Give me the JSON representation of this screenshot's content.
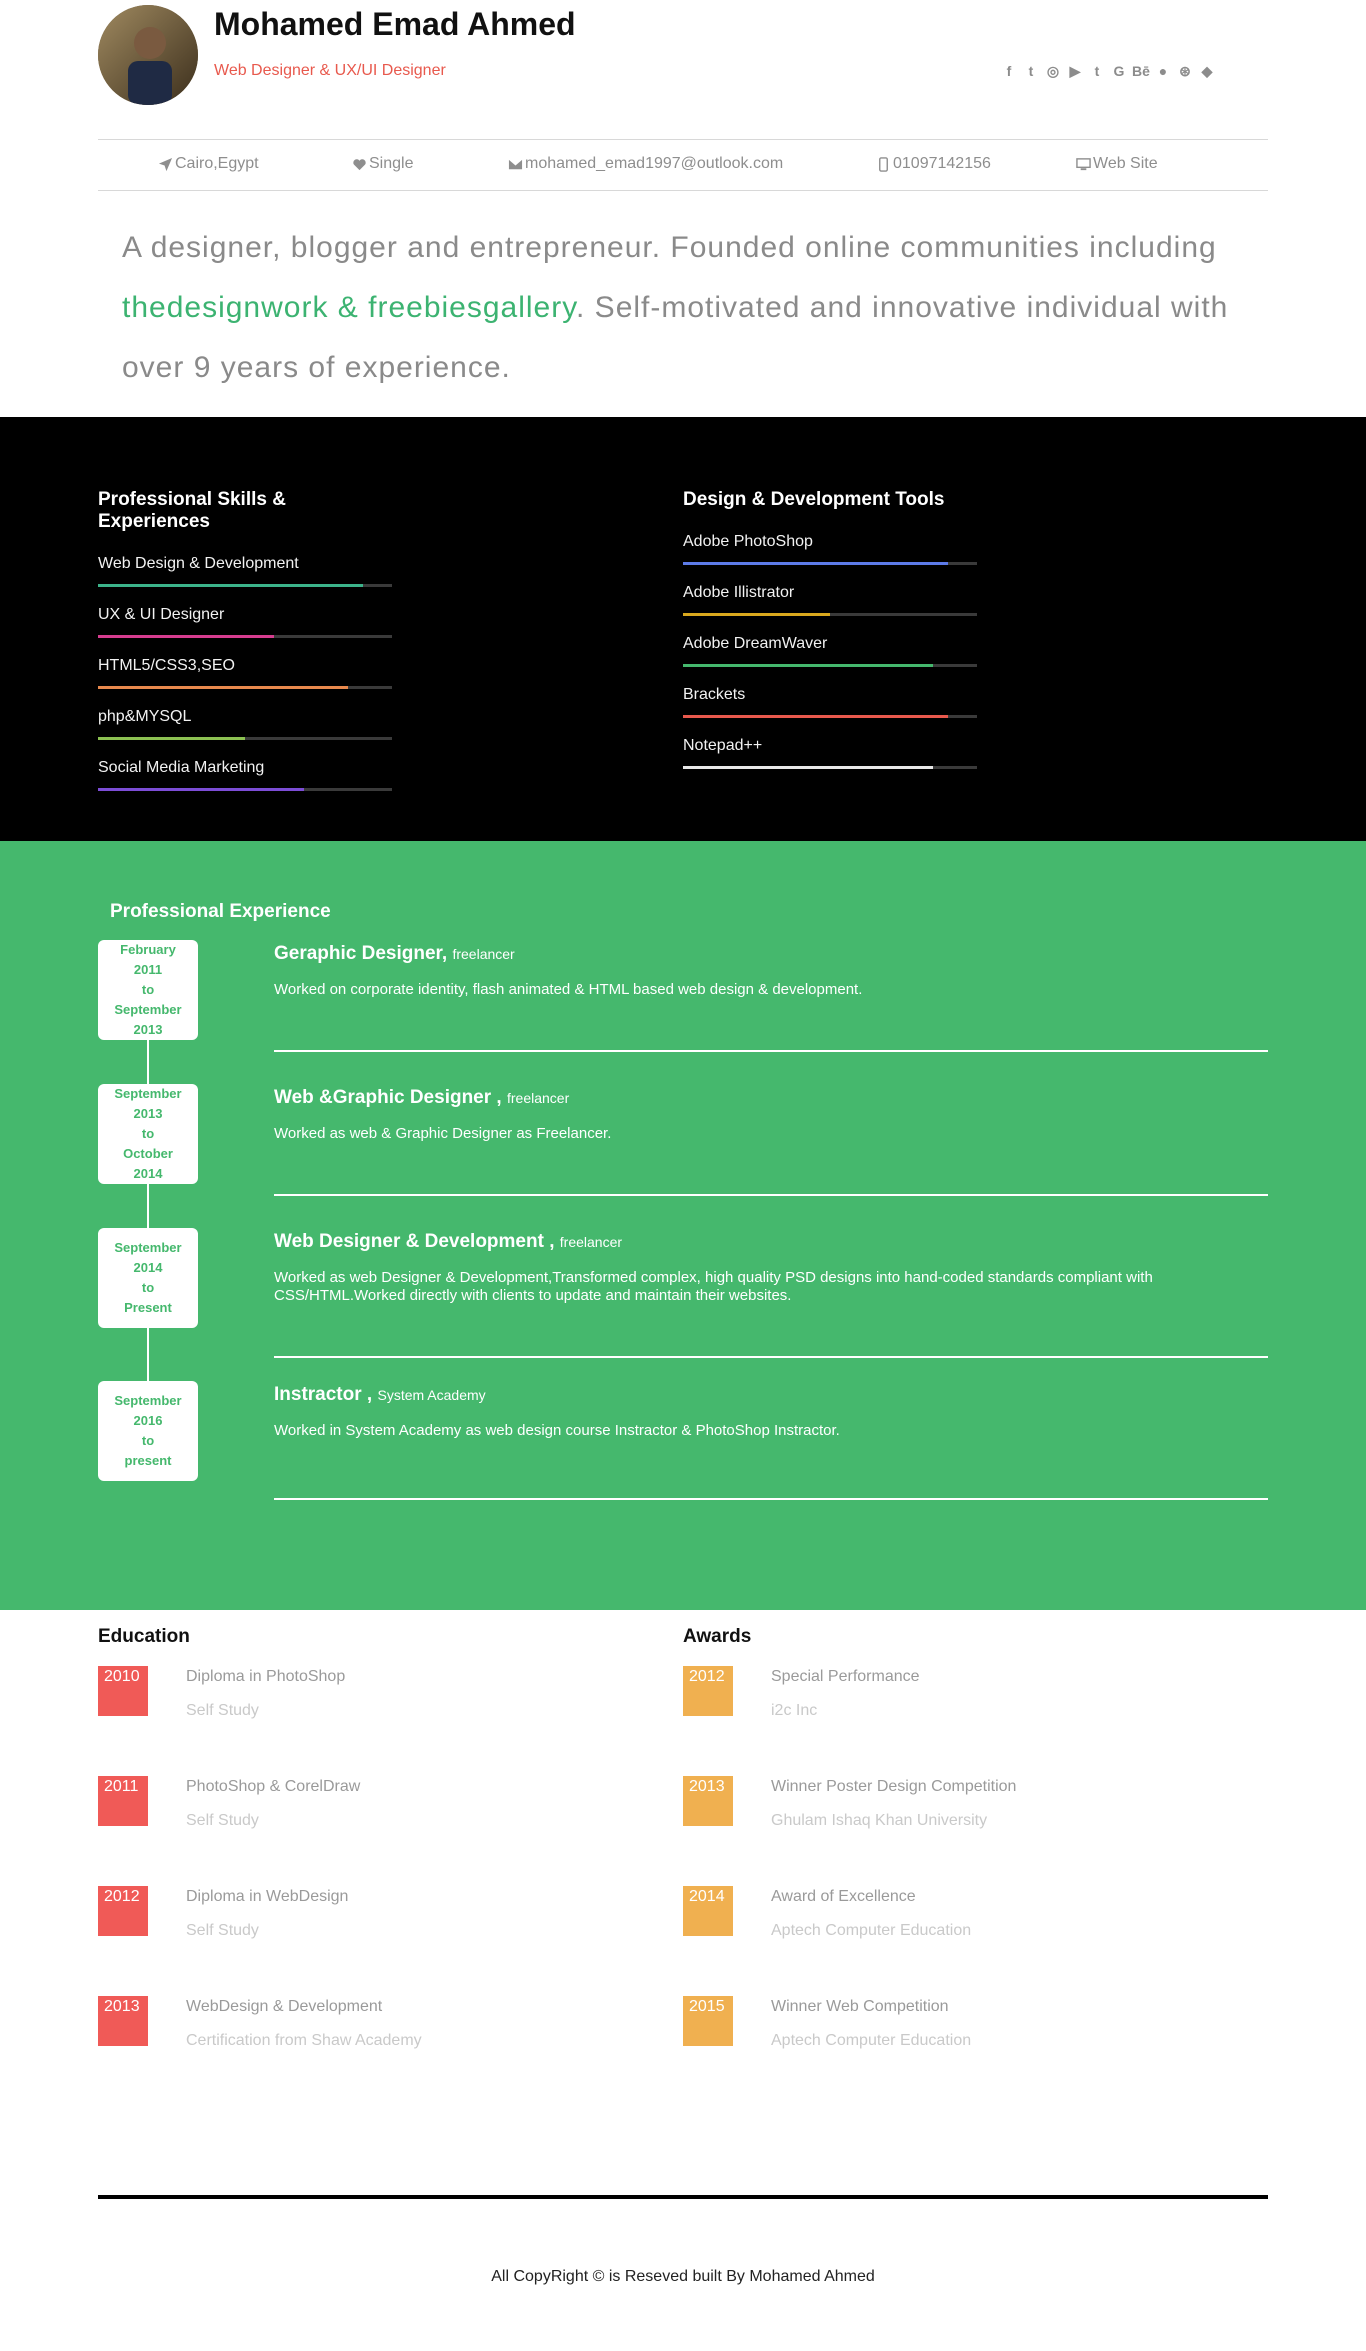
{
  "profile": {
    "name": "Mohamed Emad Ahmed",
    "title": "Web Designer & UX/UI Designer",
    "socials": [
      "facebook-icon",
      "twitter-icon",
      "instagram-icon",
      "youtube-icon",
      "tumblr-icon",
      "google-plus-icon",
      "behance-icon",
      "flickr-icon",
      "dribbble-icon",
      "dropbox-icon"
    ]
  },
  "info": {
    "location": "Cairo,Egypt",
    "status": "Single",
    "email": "mohamed_emad1997@outlook.com",
    "phone": "01097142156",
    "website": "Web Site"
  },
  "bio": {
    "part1": "A designer, blogger and entrepreneur. Founded online communities including ",
    "highlight": "thedesignwork & freebiesgallery",
    "part2": ". Self-motivated and innovative individual with over 9 years of experience."
  },
  "skills": {
    "title": "Professional Skills & Experiences",
    "items": [
      {
        "label": "Web Design & Development",
        "level": 0.9,
        "color": "#3cb38a"
      },
      {
        "label": "UX & UI Designer",
        "level": 0.6,
        "color": "#d63d8f"
      },
      {
        "label": "HTML5/CSS3,SEO",
        "level": 0.85,
        "color": "#e8894d"
      },
      {
        "label": "php&MYSQL",
        "level": 0.5,
        "color": "#8cc152"
      },
      {
        "label": "Social Media Marketing",
        "level": 0.7,
        "color": "#7c4dd6"
      }
    ]
  },
  "tools": {
    "title": "Design & Development Tools",
    "items": [
      {
        "label": "Adobe PhotoShop",
        "level": 0.9,
        "color": "#5d7be8"
      },
      {
        "label": "Adobe Illistrator",
        "level": 0.5,
        "color": "#d9a81e"
      },
      {
        "label": "Adobe DreamWaver",
        "level": 0.85,
        "color": "#45b86d"
      },
      {
        "label": "Brackets",
        "level": 0.9,
        "color": "#e8594d"
      },
      {
        "label": "Notepad++",
        "level": 0.85,
        "color": "#e8e8e8"
      }
    ]
  },
  "experience": {
    "title": "Professional Experience",
    "jobs": [
      {
        "date": [
          "February",
          "2011",
          "to",
          "September",
          "2013"
        ],
        "role": "Geraphic Designer,",
        "type": "freelancer",
        "desc": "Worked on corporate identity, flash animated & HTML based web design & development."
      },
      {
        "date": [
          "September",
          "2013",
          "to",
          "October",
          "2014"
        ],
        "role": "Web &Graphic Designer ,",
        "type": "freelancer",
        "desc": "Worked as web & Graphic Designer as Freelancer."
      },
      {
        "date": [
          "September",
          "2014",
          "to",
          "Present"
        ],
        "role": "Web Designer & Development ,",
        "type": "freelancer",
        "desc": "Worked as web Designer & Development,Transformed complex, high quality PSD designs into hand-coded standards compliant with CSS/HTML.Worked directly with clients to update and maintain their websites."
      },
      {
        "date": [
          "September",
          "2016",
          "to",
          "present"
        ],
        "role": "Instractor ,",
        "type": "System Academy",
        "desc": "Worked in System Academy as web design course Instractor & PhotoShop Instractor."
      }
    ]
  },
  "education": {
    "title": "Education",
    "color": "#f05a57",
    "items": [
      {
        "year": "2010",
        "title": "Diploma in PhotoShop",
        "sub": "Self Study"
      },
      {
        "year": "2011",
        "title": "PhotoShop & CorelDraw",
        "sub": "Self Study"
      },
      {
        "year": "2012",
        "title": "Diploma in WebDesign",
        "sub": "Self Study"
      },
      {
        "year": "2013",
        "title": "WebDesign & Development",
        "sub": "Certification from Shaw Academy"
      }
    ]
  },
  "awards": {
    "title": "Awards",
    "color": "#f0b050",
    "items": [
      {
        "year": "2012",
        "title": "Special Performance",
        "sub": "i2c Inc"
      },
      {
        "year": "2013",
        "title": "Winner Poster Design Competition",
        "sub": "Ghulam Ishaq Khan University"
      },
      {
        "year": "2014",
        "title": "Award of Excellence",
        "sub": "Aptech Computer Education"
      },
      {
        "year": "2015",
        "title": "Winner Web Competition",
        "sub": "Aptech Computer Education"
      }
    ]
  },
  "footer": {
    "copyright": "All CopyRight © is Reseved built By Mohamed Ahmed"
  }
}
